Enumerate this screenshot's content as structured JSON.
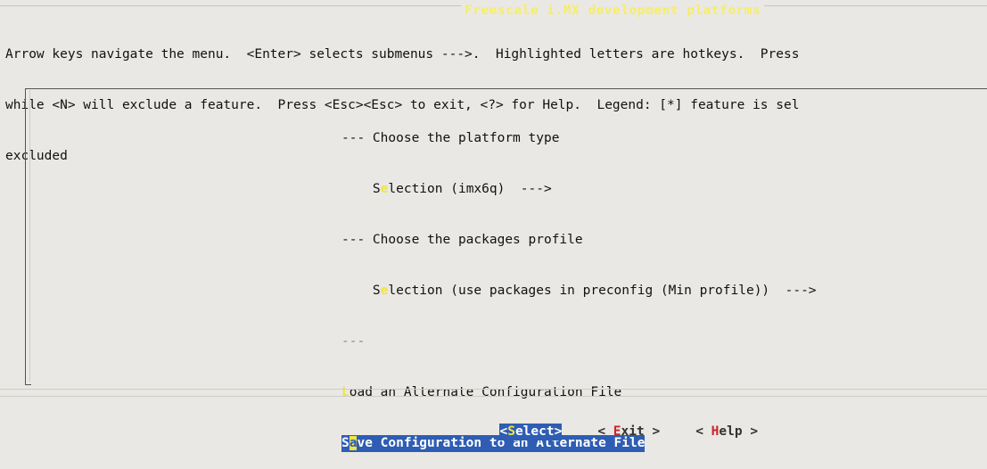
{
  "window": {
    "title": "Freescale i.MX development platforms"
  },
  "help_text": [
    "Arrow keys navigate the menu.  <Enter> selects submenus --->.  Highlighted letters are hotkeys.  Press",
    "while <N> will exclude a feature.  Press <Esc><Esc> to exit, <?> for Help.  Legend: [*] feature is sel",
    "excluded"
  ],
  "menu": {
    "items": [
      {
        "prefix": "--- ",
        "hot": "",
        "rest": "Choose the platform type",
        "kind": "comment"
      },
      {
        "prefix": "    S",
        "hot": "e",
        "rest": "lection (imx6q)  --->",
        "kind": "choice"
      },
      {
        "prefix": "--- ",
        "hot": "",
        "rest": "Choose the packages profile",
        "kind": "comment"
      },
      {
        "prefix": "    S",
        "hot": "e",
        "rest": "lection (use packages in preconfig (Min profile))  --->",
        "kind": "choice"
      },
      {
        "prefix": "---",
        "hot": "",
        "rest": "",
        "kind": "separator"
      },
      {
        "prefix": "",
        "hot": "L",
        "rest": "oad an Alternate Configuration File",
        "kind": "action"
      },
      {
        "prefix": "S",
        "hot": "a",
        "rest": "ve Configuration to an Alternate File",
        "kind": "action-selected"
      }
    ]
  },
  "buttons": {
    "select": {
      "open": "<",
      "key": "S",
      "rest": "elect",
      "close": ">"
    },
    "exit": {
      "open": "< ",
      "key": "E",
      "rest": "xit",
      "close": " >"
    },
    "help": {
      "open": "< ",
      "key": "H",
      "rest": "elp",
      "close": " >"
    }
  },
  "colors": {
    "background": "#eae8e4",
    "selection": "#2e5db3",
    "hotkey": "#f0e34a",
    "button_hotkey": "#c8262b",
    "title": "#f5ee6a"
  }
}
